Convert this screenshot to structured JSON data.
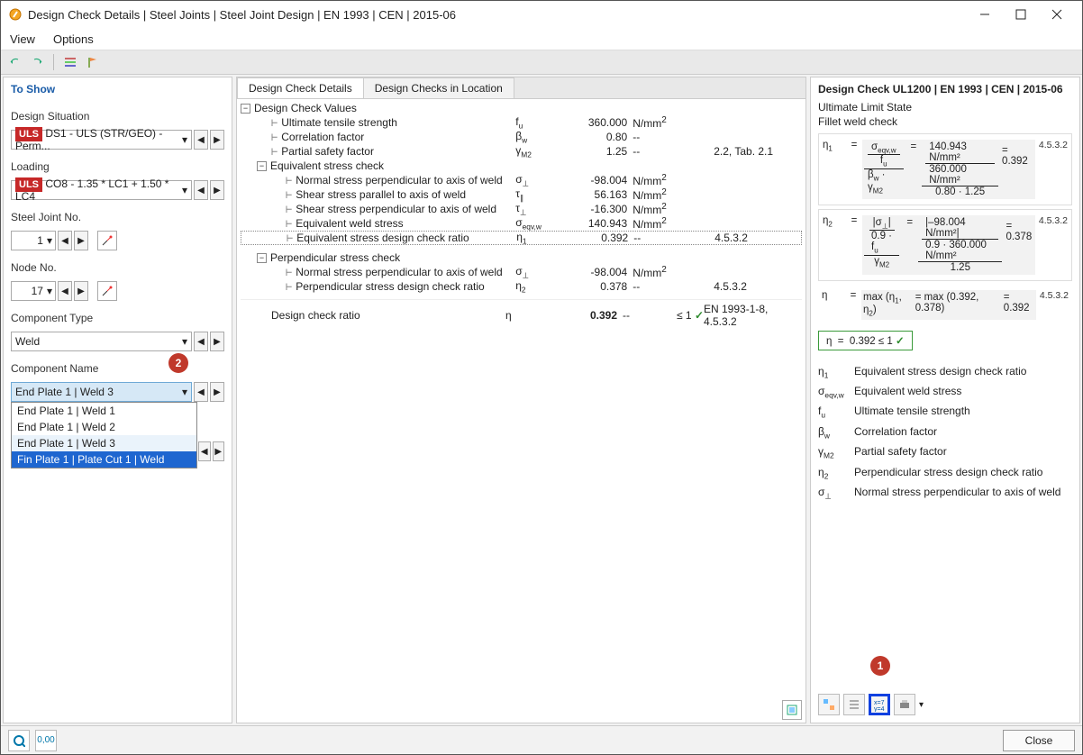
{
  "window": {
    "title": "Design Check Details | Steel Joints | Steel Joint Design | EN 1993 | CEN | 2015-06"
  },
  "menu": {
    "view": "View",
    "options": "Options"
  },
  "sidebar": {
    "to_show": "To Show",
    "design_situation": "Design Situation",
    "uls": "ULS",
    "ds_value": "DS1 - ULS (STR/GEO) - Perm...",
    "loading": "Loading",
    "load_value": "CO8 - 1.35 * LC1 + 1.50 * LC4",
    "steel_joint": "Steel Joint No.",
    "steel_joint_val": "1",
    "node_no": "Node No.",
    "node_val": "17",
    "component_type": "Component Type",
    "component_type_val": "Weld",
    "component_name": "Component Name",
    "component_name_val": "End Plate 1 | Weld 3",
    "dropdown": {
      "i0": "End Plate 1 | Weld 1",
      "i1": "End Plate 1 | Weld 2",
      "i2": "End Plate 1 | Weld 3",
      "i3": "Fin Plate 1 | Plate Cut 1 | Weld"
    }
  },
  "tabs": {
    "t0": "Design Check Details",
    "t1": "Design Checks in Location"
  },
  "tree": {
    "g0": "Design Check Values",
    "r0_l": "Ultimate tensile strength",
    "r0_s": "f",
    "r0_sub": "u",
    "r0_v": "360.000",
    "r0_u": "N/mm",
    "r0_sup": "2",
    "r1_l": "Correlation factor",
    "r1_s": "β",
    "r1_sub": "w",
    "r1_v": "0.80",
    "r1_u": "--",
    "r2_l": "Partial safety factor",
    "r2_s": "γ",
    "r2_sub": "M2",
    "r2_v": "1.25",
    "r2_u": "--",
    "r2_ref": "2.2, Tab. 2.1",
    "g1": "Equivalent stress check",
    "r3_l": "Normal stress perpendicular to axis of weld",
    "r3_s": "σ",
    "r3_sub": "⊥",
    "r3_v": "-98.004",
    "r3_u": "N/mm",
    "r3_sup": "2",
    "r4_l": "Shear stress parallel to axis of weld",
    "r4_s": "τ",
    "r4_sub": "∥",
    "r4_v": "56.163",
    "r4_u": "N/mm",
    "r4_sup": "2",
    "r5_l": "Shear stress perpendicular to axis of weld",
    "r5_s": "τ",
    "r5_sub": "⊥",
    "r5_v": "-16.300",
    "r5_u": "N/mm",
    "r5_sup": "2",
    "r6_l": "Equivalent weld stress",
    "r6_s": "σ",
    "r6_sub": "eqv,w",
    "r6_v": "140.943",
    "r6_u": "N/mm",
    "r6_sup": "2",
    "r7_l": "Equivalent stress design check ratio",
    "r7_s": "η",
    "r7_sub": "1",
    "r7_v": "0.392",
    "r7_u": "--",
    "r7_ref": "4.5.3.2",
    "g2": "Perpendicular stress check",
    "r8_l": "Normal stress perpendicular to axis of weld",
    "r8_s": "σ",
    "r8_sub": "⊥",
    "r8_v": "-98.004",
    "r8_u": "N/mm",
    "r8_sup": "2",
    "r9_l": "Perpendicular stress design check ratio",
    "r9_s": "η",
    "r9_sub": "2",
    "r9_v": "0.378",
    "r9_u": "--",
    "r9_ref": "4.5.3.2",
    "r10_l": "Design check ratio",
    "r10_s": "η",
    "r10_v": "0.392",
    "r10_u": "--",
    "r10_ok": "≤ 1",
    "r10_ref": "EN 1993-1-8, 4.5.3.2"
  },
  "right": {
    "title": "Design Check UL1200 | EN 1993 | CEN | 2015-06",
    "sub1": "Ultimate Limit State",
    "sub2": "Fillet weld check",
    "ref": "4.5.3.2",
    "f1a_top": "σ",
    "f1a_top_sub": "eqv,w",
    "f1a_bot": "f",
    "f1a_bot_sub": "u",
    "f1b_bot1": "β",
    "f1b_bot1_sub": "w",
    "f1b_dot": "·",
    "f1b_bot2": "γ",
    "f1b_bot2_sub": "M2",
    "f1_num_top": "140.943 N/mm²",
    "f1_num_bot": "360.000 N/mm²",
    "f1_den": "0.80  ·  1.25",
    "f1_res": "0.392",
    "f2_top": "|σ",
    "f2_top_sub": "⊥",
    "f2_top2": "|",
    "f2_bot": "0.9  ·  f",
    "f2_bot_sub": "u",
    "f2b_bot": "γ",
    "f2b_bot_sub": "M2",
    "f2_num_top": "|–98.004 N/mm²|",
    "f2_num_bot": "0.9  ·  360.000 N/mm²",
    "f2_den": "1.25",
    "f2_res": "0.378",
    "f3_a": "max (η",
    "f3_a2": ", η",
    "f3_a3": ")",
    "f3_b": "max (0.392, 0.378)",
    "f3_c": "0.392",
    "result_eta": "η",
    "result_eq": "=",
    "result_val": "0.392  ≤ 1",
    "legend": {
      "k0": "η",
      "k0s": "1",
      "v0": "Equivalent stress design check ratio",
      "k1": "σ",
      "k1s": "eqv,w",
      "v1": "Equivalent weld stress",
      "k2": "f",
      "k2s": "u",
      "v2": "Ultimate tensile strength",
      "k3": "β",
      "k3s": "w",
      "v3": "Correlation factor",
      "k4": "γ",
      "k4s": "M2",
      "v4": "Partial safety factor",
      "k5": "η",
      "k5s": "2",
      "v5": "Perpendicular stress design check ratio",
      "k6": "σ",
      "k6s": "⊥",
      "v6": "Normal stress perpendicular to axis of weld"
    }
  },
  "footer": {
    "close": "Close"
  }
}
